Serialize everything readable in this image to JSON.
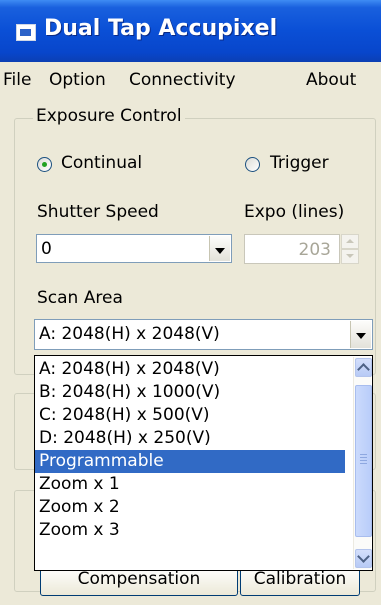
{
  "window": {
    "title": "Dual Tap Accupixel"
  },
  "menu": [
    "File",
    "Option",
    "Connectivity",
    "About"
  ],
  "exposure": {
    "group_title": "Exposure Control",
    "radio_continual": "Continual",
    "radio_trigger": "Trigger",
    "selected_mode": "Continual",
    "shutter_label": "Shutter Speed",
    "shutter_value": "0",
    "expo_label": "Expo (lines)",
    "expo_value": "203",
    "scan_label": "Scan Area",
    "scan_value": "A: 2048(H) x 2048(V)"
  },
  "scan_options": [
    "A: 2048(H) x 2048(V)",
    "B: 2048(H) x 1000(V)",
    "C: 2048(H) x 500(V)",
    "D: 2048(H) x 250(V)",
    "Programmable",
    "Zoom x 1",
    "Zoom x 2",
    "Zoom x 3"
  ],
  "highlighted_option": "Programmable",
  "buttons": {
    "compensation": "Compensation",
    "calibration": "Calibration"
  },
  "colors": {
    "titlebar": "#0a4fd6",
    "selection": "#316ac5",
    "radio_dot": "#21a121",
    "face": "#ece9d8"
  }
}
